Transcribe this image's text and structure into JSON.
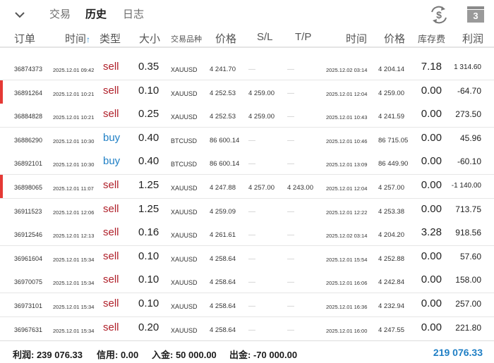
{
  "topbar": {
    "tabs": [
      "交易",
      "历史",
      "日志"
    ],
    "active_tab": "历史",
    "calendar_badge": "3"
  },
  "columns": {
    "order": "订单",
    "open_time": "时间",
    "type": "类型",
    "volume": "大小",
    "symbol": "交易品种",
    "open_price": "价格",
    "sl": "S/L",
    "tp": "T/P",
    "close_time": "时间",
    "close_price": "价格",
    "swap": "库存费",
    "profit": "利润"
  },
  "rows": [
    {
      "order": "36874373",
      "open_time": "2025.12.01 09:42",
      "type": "sell",
      "volume": "0.35",
      "symbol": "XAUUSD",
      "open_price": "4 241.70",
      "sl": "—",
      "tp": "—",
      "close_time": "2025.12.02 03:14",
      "close_price": "4 204.14",
      "swap": "7.18",
      "profit": "1 314.60",
      "marker": false,
      "small_profit": true
    },
    {
      "order": "36891264",
      "open_time": "2025.12.01 10:21",
      "type": "sell",
      "volume": "0.10",
      "symbol": "XAUUSD",
      "open_price": "4 252.53",
      "sl": "4 259.00",
      "tp": "—",
      "close_time": "2025.12.01 12:04",
      "close_price": "4 259.00",
      "swap": "0.00",
      "profit": "-64.70",
      "marker": true
    },
    {
      "order": "36884828",
      "open_time": "2025.12.01 10:21",
      "type": "sell",
      "volume": "0.25",
      "symbol": "XAUUSD",
      "open_price": "4 252.53",
      "sl": "4 259.00",
      "tp": "—",
      "close_time": "2025.12.01 10:43",
      "close_price": "4 241.59",
      "swap": "0.00",
      "profit": "273.50",
      "marker": false
    },
    {
      "order": "36886290",
      "open_time": "2025.12.01 10:30",
      "type": "buy",
      "volume": "0.40",
      "symbol": "BTCUSD",
      "open_price": "86 600.14",
      "sl": "—",
      "tp": "—",
      "close_time": "2025.12.01 10:46",
      "close_price": "86 715.05",
      "swap": "0.00",
      "profit": "45.96",
      "marker": false
    },
    {
      "order": "36892101",
      "open_time": "2025.12.01 10:30",
      "type": "buy",
      "volume": "0.40",
      "symbol": "BTCUSD",
      "open_price": "86 600.14",
      "sl": "—",
      "tp": "—",
      "close_time": "2025.12.01 13:09",
      "close_price": "86 449.90",
      "swap": "0.00",
      "profit": "-60.10",
      "marker": false
    },
    {
      "order": "36898065",
      "open_time": "2025.12.01 11:07",
      "type": "sell",
      "volume": "1.25",
      "symbol": "XAUUSD",
      "open_price": "4 247.88",
      "sl": "4 257.00",
      "tp": "4 243.00",
      "close_time": "2025.12.01 12:04",
      "close_price": "4 257.00",
      "swap": "0.00",
      "profit": "-1 140.00",
      "marker": true,
      "small_profit": true
    },
    {
      "order": "36911523",
      "open_time": "2025.12.01 12:06",
      "type": "sell",
      "volume": "1.25",
      "symbol": "XAUUSD",
      "open_price": "4 259.09",
      "sl": "—",
      "tp": "—",
      "close_time": "2025.12.01 12:22",
      "close_price": "4 253.38",
      "swap": "0.00",
      "profit": "713.75",
      "marker": false
    },
    {
      "order": "36912546",
      "open_time": "2025.12.01 12:13",
      "type": "sell",
      "volume": "0.16",
      "symbol": "XAUUSD",
      "open_price": "4 261.61",
      "sl": "—",
      "tp": "—",
      "close_time": "2025.12.02 03:14",
      "close_price": "4 204.20",
      "swap": "3.28",
      "profit": "918.56",
      "marker": false
    },
    {
      "order": "36961604",
      "open_time": "2025.12.01 15:34",
      "type": "sell",
      "volume": "0.10",
      "symbol": "XAUUSD",
      "open_price": "4 258.64",
      "sl": "—",
      "tp": "—",
      "close_time": "2025.12.01 15:54",
      "close_price": "4 252.88",
      "swap": "0.00",
      "profit": "57.60",
      "marker": false
    },
    {
      "order": "36970075",
      "open_time": "2025.12.01 15:34",
      "type": "sell",
      "volume": "0.10",
      "symbol": "XAUUSD",
      "open_price": "4 258.64",
      "sl": "—",
      "tp": "—",
      "close_time": "2025.12.01 16:06",
      "close_price": "4 242.84",
      "swap": "0.00",
      "profit": "158.00",
      "marker": false
    },
    {
      "order": "36973101",
      "open_time": "2025.12.01 15:34",
      "type": "sell",
      "volume": "0.10",
      "symbol": "XAUUSD",
      "open_price": "4 258.64",
      "sl": "—",
      "tp": "—",
      "close_time": "2025.12.01 16:36",
      "close_price": "4 232.94",
      "swap": "0.00",
      "profit": "257.00",
      "marker": false
    },
    {
      "order": "36967631",
      "open_time": "2025.12.01 15:34",
      "type": "sell",
      "volume": "0.20",
      "symbol": "XAUUSD",
      "open_price": "4 258.64",
      "sl": "—",
      "tp": "—",
      "close_time": "2025.12.01 16:00",
      "close_price": "4 247.55",
      "swap": "0.00",
      "profit": "221.80",
      "marker": false
    }
  ],
  "footer": {
    "profit": "利润: 239 076.33",
    "credit": "信用: 0.00",
    "deposit": "入金: 50 000.00",
    "withdrawal": "出金: -70 000.00",
    "balance": "219 076.33"
  },
  "colors": {
    "sell": "#b0202a",
    "buy": "#1f7fc5",
    "marker": "#e53935",
    "balance": "#1f7fc5"
  },
  "icons": {
    "collapse": "chevron-down-icon",
    "sort": "sort-asc-icon",
    "currency_refresh": "dollar-refresh-icon",
    "calendar": "calendar-icon"
  }
}
